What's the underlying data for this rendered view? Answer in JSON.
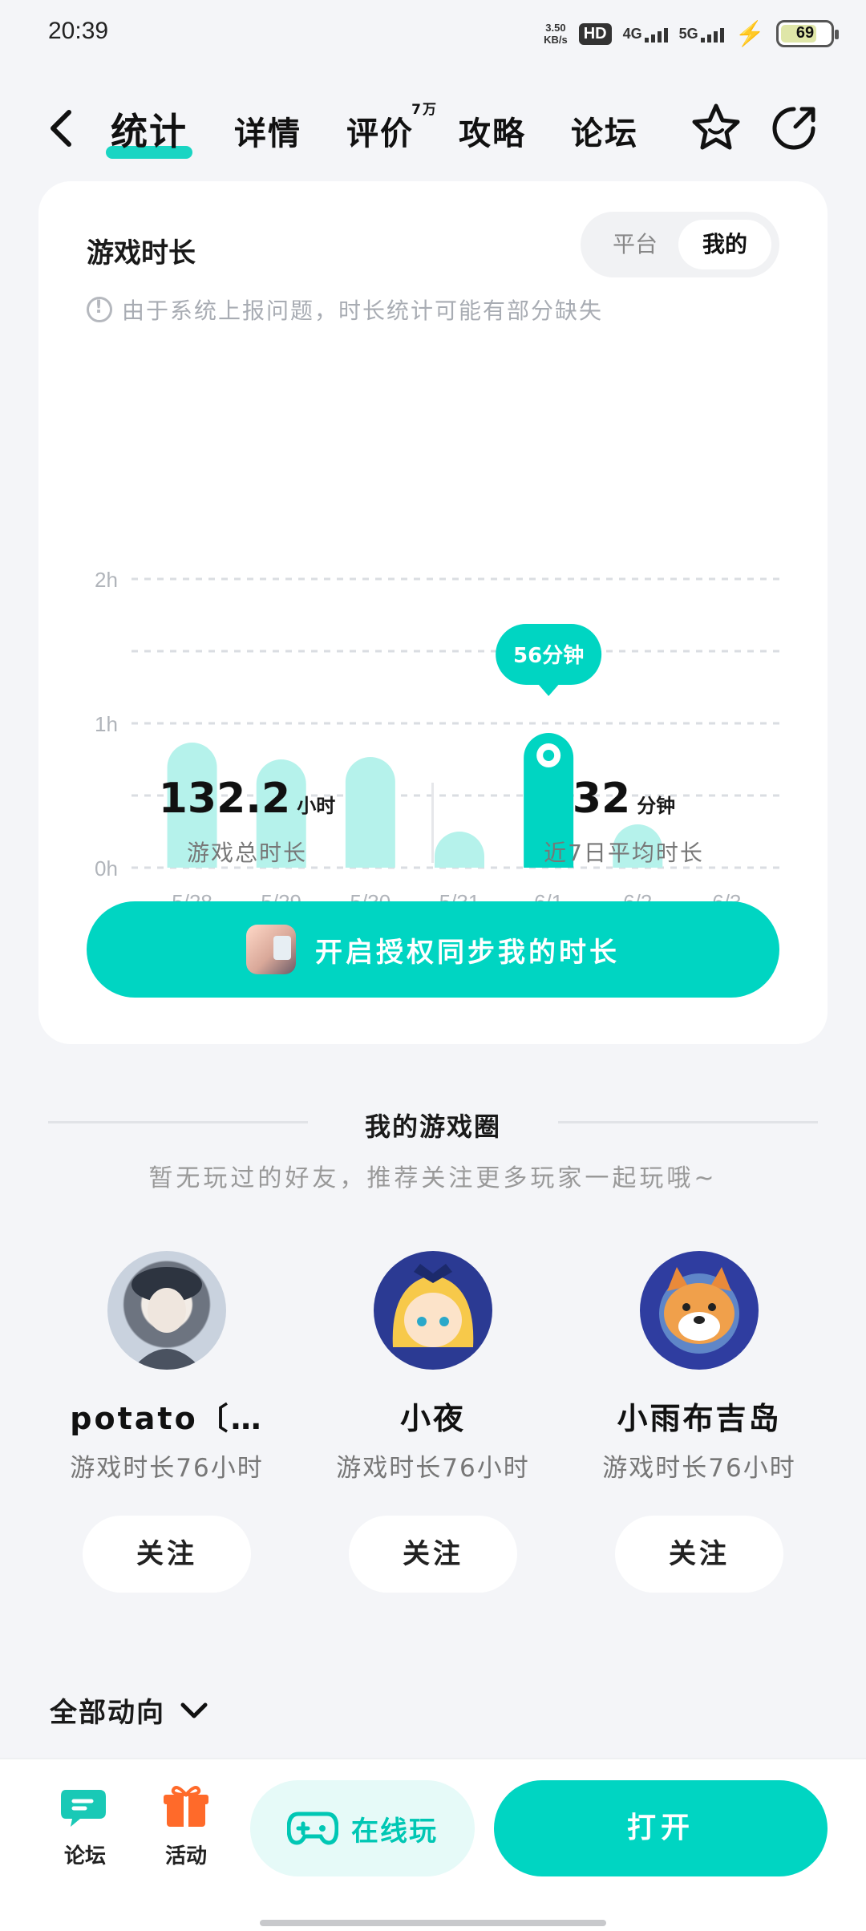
{
  "status_bar": {
    "time": "20:39",
    "speed_value": "3.50",
    "speed_unit": "KB/s",
    "hd": "HD",
    "net1": "4G",
    "net2": "5G",
    "battery": "69"
  },
  "nav": {
    "tabs": [
      {
        "label": "统计",
        "active": true
      },
      {
        "label": "详情"
      },
      {
        "label": "评价",
        "badge": "7万"
      },
      {
        "label": "攻略"
      },
      {
        "label": "论坛"
      }
    ],
    "icons": [
      "back-icon",
      "star-icon",
      "share-icon"
    ]
  },
  "play_time": {
    "title": "游戏时长",
    "toggle": {
      "platform": "平台",
      "mine": "我的",
      "selected": "我的"
    },
    "notice": "由于系统上报问题，时长统计可能有部分缺失",
    "tooltip": "56分钟",
    "total_value": "132.2",
    "total_unit": "小时",
    "total_label": "游戏总时长",
    "avg_value": "32",
    "avg_unit": "分钟",
    "avg_label": "近7日平均时长",
    "sync_button": "开启授权同步我的时长"
  },
  "chart_data": {
    "type": "bar",
    "categories": [
      "5/28",
      "5/29",
      "5/30",
      "5/31",
      "6/1",
      "6/2",
      "6/3"
    ],
    "values": [
      52,
      45,
      46,
      15,
      56,
      18,
      0
    ],
    "unit": "minutes",
    "y_ticks": [
      "0h",
      "1h",
      "2h"
    ],
    "ylim": [
      0,
      120
    ],
    "highlight_index": 4,
    "colors": {
      "bar": "#B5F2EB",
      "highlight": "#00D5C2",
      "grid": "#DADDE2",
      "tick": "#B0B4BA"
    }
  },
  "game_circle": {
    "title": "我的游戏圈",
    "subtitle": "暂无玩过的好友，推荐关注更多玩家一起玩哦~",
    "friends": [
      {
        "name": "potato〔…",
        "time": "游戏时长76小时",
        "follow": "关注"
      },
      {
        "name": "小夜",
        "time": "游戏时长76小时",
        "follow": "关注"
      },
      {
        "name": "小雨布吉岛",
        "time": "游戏时长76小时",
        "follow": "关注"
      }
    ]
  },
  "feed": {
    "label": "全部动向"
  },
  "bottom_bar": {
    "forum": "论坛",
    "activity": "活动",
    "online_play": "在线玩",
    "open": "打开"
  },
  "colors": {
    "accent": "#00D5C2",
    "accent_light": "#B5F2EB",
    "background": "#F4F5F8"
  }
}
